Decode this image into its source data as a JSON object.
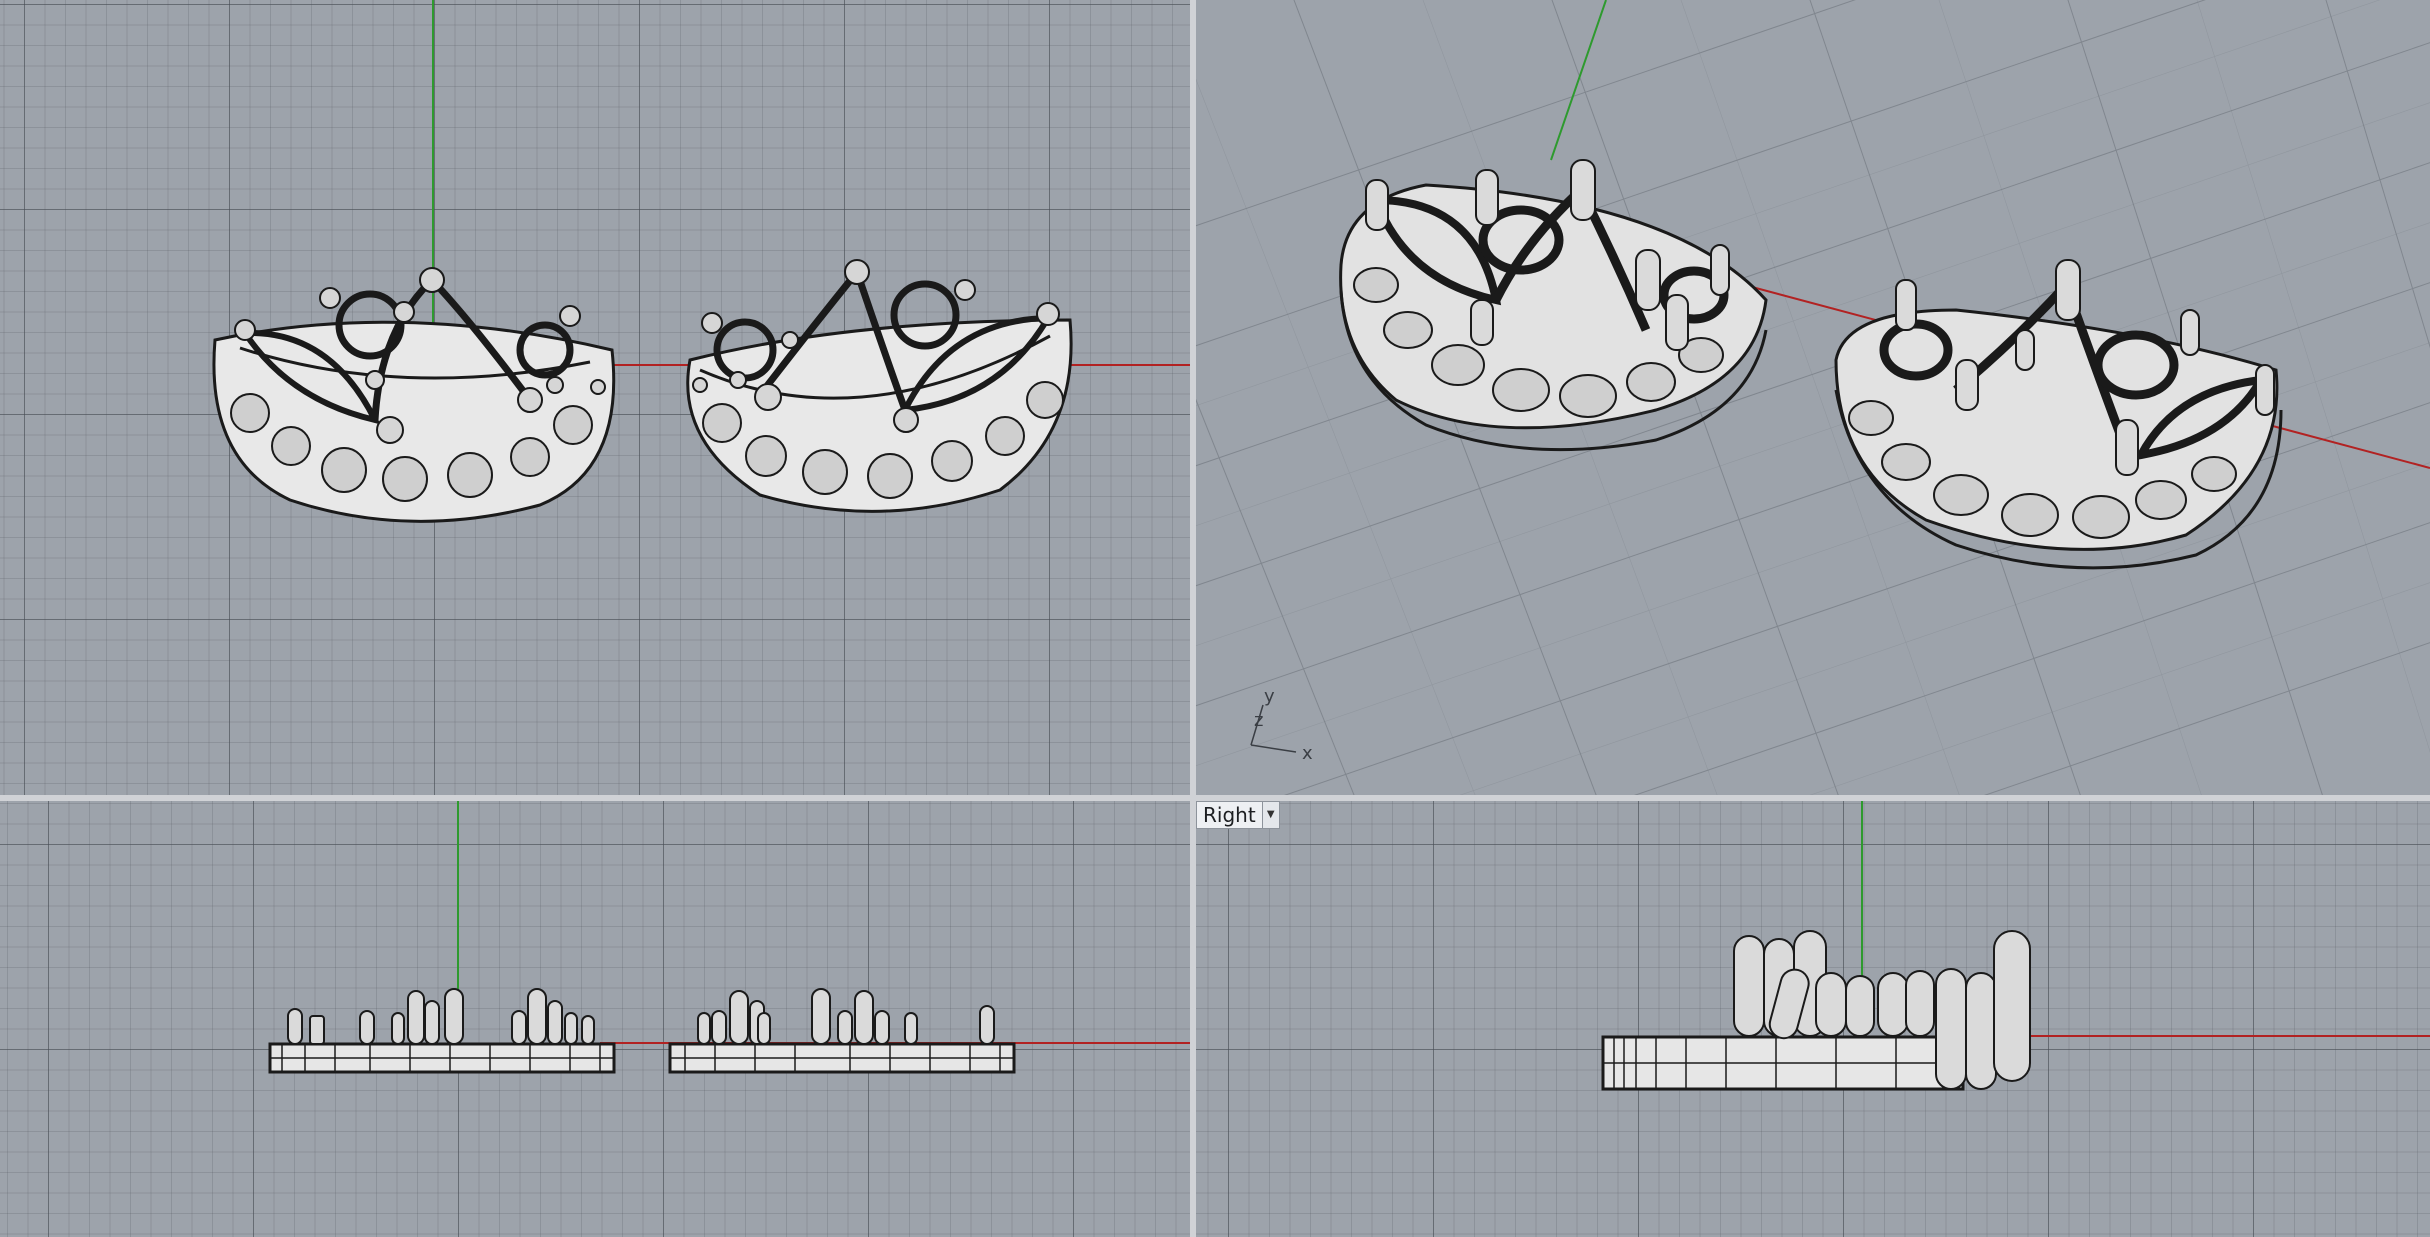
{
  "viewports": [
    {
      "name": "top",
      "title": ""
    },
    {
      "name": "perspective",
      "title": ""
    },
    {
      "name": "front",
      "title": ""
    },
    {
      "name": "right",
      "title": "Right",
      "dropdown_icon": "triangle-down-icon"
    }
  ],
  "axis_triad": {
    "x": "x",
    "y": "y",
    "z": "z"
  },
  "colors": {
    "viewport_bg": "#9da3ab",
    "grid_major": "#5a6068",
    "x_axis": "#b22222",
    "y_axis": "#2e9a2e",
    "model_fill": "#e7e7e7",
    "model_edge": "#1a1a1a",
    "separator": "#d0d2d6"
  }
}
